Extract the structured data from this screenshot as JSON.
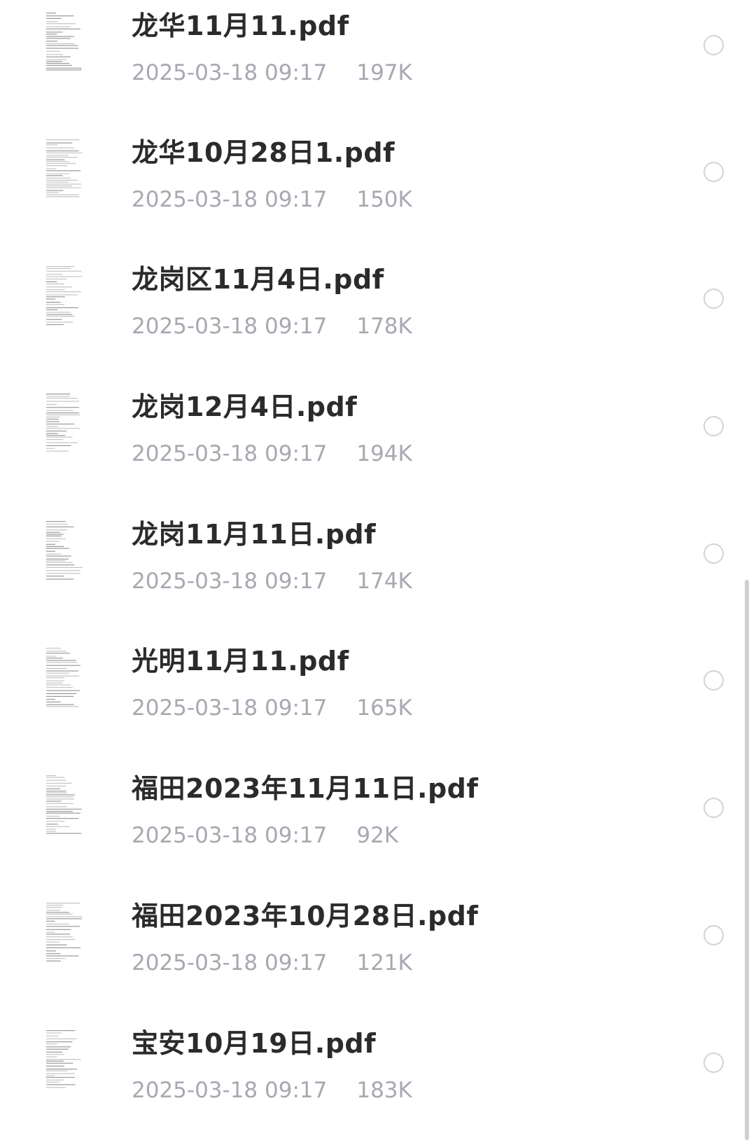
{
  "files": [
    {
      "name": "龙华11月11.pdf",
      "modified": "2025-03-18 09:17",
      "size": "197K"
    },
    {
      "name": "龙华10月28日1.pdf",
      "modified": "2025-03-18 09:17",
      "size": "150K"
    },
    {
      "name": "龙岗区11月4日.pdf",
      "modified": "2025-03-18 09:17",
      "size": "178K"
    },
    {
      "name": "龙岗12月4日.pdf",
      "modified": "2025-03-18 09:17",
      "size": "194K"
    },
    {
      "name": "龙岗11月11日.pdf",
      "modified": "2025-03-18 09:17",
      "size": "174K"
    },
    {
      "name": "光明11月11.pdf",
      "modified": "2025-03-18 09:17",
      "size": "165K"
    },
    {
      "name": "福田2023年11月11日.pdf",
      "modified": "2025-03-18 09:17",
      "size": "92K"
    },
    {
      "name": "福田2023年10月28日.pdf",
      "modified": "2025-03-18 09:17",
      "size": "121K"
    },
    {
      "name": "宝安10月19日.pdf",
      "modified": "2025-03-18 09:17",
      "size": "183K"
    }
  ],
  "icons": {
    "thumbnail": "pdf-page-thumbnail-icon",
    "select": "radio-circle-icon"
  },
  "colors": {
    "name_text": "#2b2b2b",
    "meta_text": "#a7a9b1",
    "radio_border": "#d2d3d7",
    "scrollbar": "#cfcfd3"
  }
}
